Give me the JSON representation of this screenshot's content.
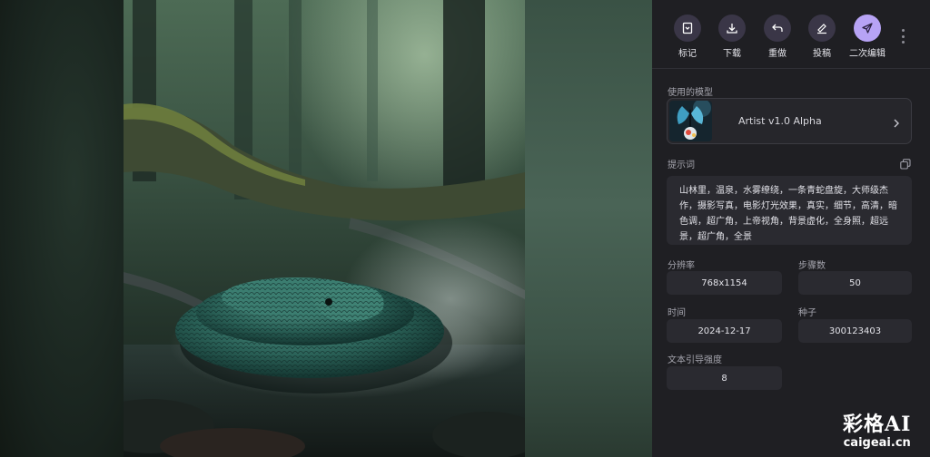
{
  "toolbar": {
    "actions": [
      {
        "label": "标记",
        "icon": "bookmark-icon"
      },
      {
        "label": "下载",
        "icon": "download-icon"
      },
      {
        "label": "重做",
        "icon": "redo-icon"
      },
      {
        "label": "投稿",
        "icon": "submit-icon"
      },
      {
        "label": "二次编辑",
        "icon": "send-icon"
      }
    ],
    "more_icon": "more-vertical-icon",
    "accent_color": "#b7a3f5"
  },
  "model": {
    "section_label": "使用的模型",
    "name": "Artist v1.0 Alpha"
  },
  "prompt": {
    "section_label": "提示词",
    "text": "山林里，温泉，水雾缭绕，一条青蛇盘旋，大师级杰作，摄影写真，电影灯光效果，真实，细节，高清，暗色调，超广角，上帝视角，背景虚化，全身照，超远景，超广角，全景"
  },
  "params": {
    "resolution_label": "分辨率",
    "resolution": "768x1154",
    "steps_label": "步骤数",
    "steps": "50",
    "time_label": "时间",
    "time": "2024-12-17",
    "seed_label": "种子",
    "seed": "300123403",
    "guidance_label": "文本引导强度",
    "guidance": "8"
  },
  "watermark": {
    "title": "彩格AI",
    "domain": "caigeai.cn"
  }
}
